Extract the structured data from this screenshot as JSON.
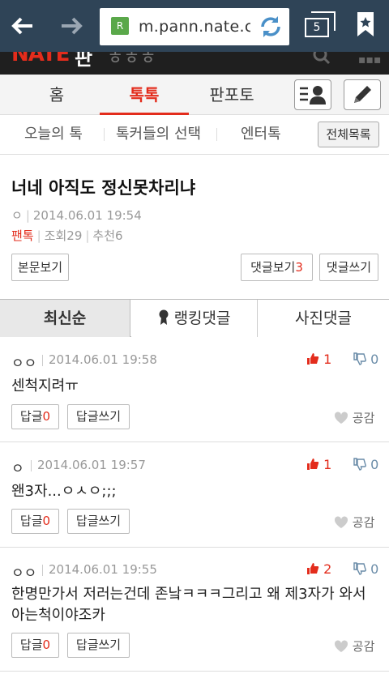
{
  "browser": {
    "url": "m.pann.nate.com",
    "tab_count": "5",
    "favicon_letter": "R"
  },
  "site": {
    "logo": "NATE",
    "logo_sub": "판",
    "logo_extra": "ㅎㅎㅎ"
  },
  "main_tabs": [
    "홈",
    "톡톡",
    "판포토"
  ],
  "sub_tabs": [
    "오늘의 톡",
    "톡커들의 선택",
    "엔터톡"
  ],
  "all_list_label": "전체목록",
  "post": {
    "title": "너네 아직도 정신못차리냐",
    "author": "ㅇ",
    "date": "2014.06.01 19:54",
    "category": "팬톡",
    "views": "조회29",
    "recommend": "추천6"
  },
  "buttons": {
    "view_body": "본문보기",
    "view_comments": "댓글보기",
    "comment_count": "3",
    "write_comment": "댓글쓰기"
  },
  "sort_tabs": [
    "최신순",
    "랭킹댓글",
    "사진댓글"
  ],
  "comments": [
    {
      "author": "ㅇㅇ",
      "date": "2014.06.01 19:58",
      "up": "1",
      "down": "0",
      "text": "센척지려ㅠ",
      "reply_label": "답글",
      "reply_count": "0",
      "write_reply": "답글쓰기",
      "like": "공감"
    },
    {
      "author": "ㅇ",
      "date": "2014.06.01 19:57",
      "up": "1",
      "down": "0",
      "text": "왠3자...ㅇㅅㅇ;;;",
      "reply_label": "답글",
      "reply_count": "0",
      "write_reply": "답글쓰기",
      "like": "공감"
    },
    {
      "author": "ㅇㅇ",
      "date": "2014.06.01 19:55",
      "up": "2",
      "down": "0",
      "text": "한명만가서 저러는건데 존낰ㅋㅋㅋ그리고 왜 제3자가 와서 아는척이야조카",
      "reply_label": "답글",
      "reply_count": "0",
      "write_reply": "답글쓰기",
      "like": "공감"
    }
  ],
  "colors": {
    "accent": "#e32c1c",
    "browser_bar": "#2f4457",
    "header": "#1f1f1f"
  }
}
